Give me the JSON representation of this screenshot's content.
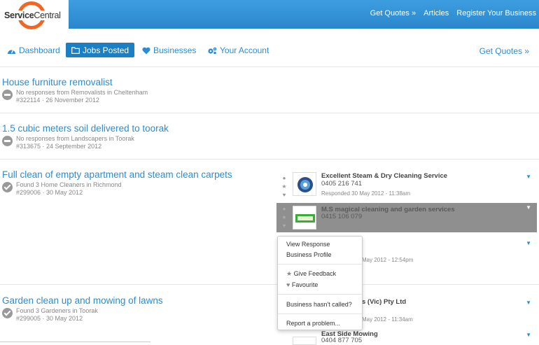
{
  "header": {
    "logo_service": "Service",
    "logo_central": "Central",
    "links": [
      "Get Quotes »",
      "Articles",
      "Register Your Business"
    ]
  },
  "nav": {
    "items": [
      {
        "label": "Dashboard",
        "icon": "dashboard-icon"
      },
      {
        "label": "Jobs Posted",
        "icon": "folder-icon"
      },
      {
        "label": "Businesses",
        "icon": "heart-icon"
      },
      {
        "label": "Your Account",
        "icon": "gears-icon"
      }
    ],
    "right_link": "Get Quotes »"
  },
  "jobs": [
    {
      "title": "House furniture removalist",
      "status": "No responses from Removalists in Cheltenham",
      "id_date": "#322114 · 26 November 2012"
    },
    {
      "title": "1.5 cubic meters soil delivered to toorak",
      "status": "No responses from Landscapers in Toorak",
      "id_date": "#313675 · 24 September 2012"
    },
    {
      "title": "Full clean of empty apartment and steam clean carpets",
      "status": "Found 3 Home Cleaners in Richmond",
      "id_date": "#299006 · 30 May 2012"
    },
    {
      "title": "Garden clean up and mowing of lawns",
      "status": "Found 3 Gardeners in Toorak",
      "id_date": "#299005 · 30 May 2012"
    }
  ],
  "responses": [
    {
      "name": "Excellent Steam & Dry Cleaning Service",
      "phone": "0405 216 741",
      "time": "Responded 30 May 2012 - 11:38am"
    },
    {
      "name": "M.S magical cleaning and garden services",
      "phone": "0415 106 079",
      "time": ""
    },
    {
      "name": "",
      "phone": "",
      "time": "May 2012 - 12:54pm"
    },
    {
      "name": "s (Vic) Pty Ltd",
      "phone": "",
      "time": "May 2012 - 11:34am"
    },
    {
      "name": "East Side Mowing",
      "phone": "0404 877 705",
      "time": ""
    }
  ],
  "menu": {
    "view_response": "View Response",
    "business_profile": "Business Profile",
    "give_feedback": "Give Feedback",
    "favourite": "Favourite",
    "not_called": "Business hasn't called?",
    "report": "Report a problem..."
  },
  "colors": {
    "brand_blue": "#2a8dd4",
    "logo_orange": "#f26522",
    "highlight_gray": "#8f8f8f"
  }
}
